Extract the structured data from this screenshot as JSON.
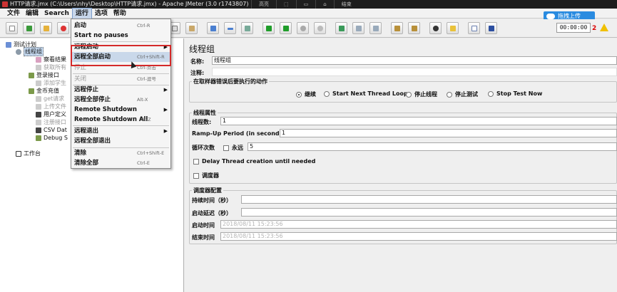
{
  "window": {
    "title": "HTTP请求.jmx (C:\\Users\\nhy\\Desktop\\HTTP请求.jmx) - Apache JMeter (3.0 r1743807)",
    "overlay_tools": [
      "高亮",
      "⬚",
      "▭",
      "⌂",
      "结束"
    ]
  },
  "menubar": {
    "items": [
      "文件",
      "编辑",
      "Search",
      "运行",
      "选项",
      "帮助"
    ]
  },
  "toolbar": {
    "timer": "00:00:00",
    "error_count": "2",
    "upload_label": "拖拽上传"
  },
  "tree": {
    "items": [
      {
        "label": "测试计划"
      },
      {
        "label": "线程组"
      },
      {
        "label": "察看结果"
      },
      {
        "label": "获取所有"
      },
      {
        "label": "登录接口"
      },
      {
        "label": "添加学生"
      },
      {
        "label": "金币充值"
      },
      {
        "label": "get请求"
      },
      {
        "label": "上传文件"
      },
      {
        "label": "用户定义"
      },
      {
        "label": "注册接口"
      },
      {
        "label": "CSV Dat"
      },
      {
        "label": "Debug S"
      },
      {
        "label": "工作台"
      }
    ]
  },
  "run_menu": {
    "items": [
      {
        "label": "启动",
        "accel": "Ctrl-R"
      },
      {
        "label": "Start no pauses",
        "accel": ""
      },
      {
        "label": "远程启动",
        "accel": ""
      },
      {
        "label": "远程全部启动",
        "accel": "Ctrl+Shift-R"
      },
      {
        "label": "停止",
        "accel": "Ctrl-点击"
      },
      {
        "label": "关闭",
        "accel": "Ctrl-逗号"
      },
      {
        "label": "远程停止",
        "accel": ""
      },
      {
        "label": "远程全部停止",
        "accel": "Alt-X"
      },
      {
        "label": "Remote Shutdown",
        "accel": ""
      },
      {
        "label": "Remote Shutdown All",
        "accel": "Alt-Z"
      },
      {
        "label": "远程退出",
        "accel": ""
      },
      {
        "label": "远程全部退出",
        "accel": ""
      },
      {
        "label": "清除",
        "accel": "Ctrl+Shift-E"
      },
      {
        "label": "清除全部",
        "accel": "Ctrl-E"
      }
    ]
  },
  "panel": {
    "title": "线程组",
    "name_label": "名称:",
    "name_value": "线程组",
    "comment_label": "注释:",
    "comment_value": "",
    "sampler_error_title": "在取样器错误后要执行的动作",
    "error_actions": [
      {
        "label": "继续",
        "selected": true
      },
      {
        "label": "Start Next Thread Loop",
        "selected": false
      },
      {
        "label": "停止线程",
        "selected": false
      },
      {
        "label": "停止测试",
        "selected": false
      },
      {
        "label": "Stop Test Now",
        "selected": false
      }
    ],
    "thread_props_title": "线程属性",
    "threads_label": "线程数:",
    "threads_value": "1",
    "rampup_label": "Ramp-Up Period (in seconds):",
    "rampup_value": "1",
    "loop_label": "循环次数",
    "forever_label": "永远",
    "loop_value": "5",
    "delay_label": "Delay Thread creation until needed",
    "scheduler_label": "调度器",
    "scheduler_config_title": "调度器配置",
    "duration_label": "持续时间（秒）",
    "duration_value": "",
    "startup_delay_label": "启动延迟（秒）",
    "startup_delay_value": "",
    "start_time_label": "启动时间",
    "start_time_value": "2018/08/11 15:23:56",
    "end_time_label": "结束时间",
    "end_time_value": "2018/08/11 15:23:56"
  }
}
